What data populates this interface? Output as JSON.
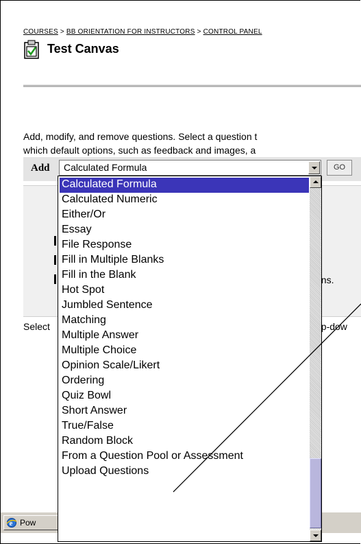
{
  "breadcrumb": {
    "items": [
      "Courses",
      "BB Orientation for Instructors",
      "Control Panel"
    ],
    "separator": ">"
  },
  "page": {
    "title": "Test Canvas",
    "title_icon": "checkbox-clipboard-icon"
  },
  "instructions": {
    "line1": "Add, modify, and remove questions. Select a question t",
    "line2": "which default options, such as feedback and images, a"
  },
  "add_bar": {
    "label": "Add",
    "selected_value": "Calculated Formula",
    "go_label": "GO"
  },
  "dropdown": {
    "options": [
      "Calculated Formula",
      "Calculated Numeric",
      "Either/Or",
      "Essay",
      "File Response",
      "Fill in Multiple Blanks",
      "Fill in the Blank",
      "Hot Spot",
      "Jumbled Sentence",
      "Matching",
      "Multiple Answer",
      "Multiple Choice",
      "Opinion Scale/Likert",
      "Ordering",
      "Quiz Bowl",
      "Short Answer",
      "True/False",
      "Random Block",
      "From a Question Pool or Assessment",
      "Upload Questions"
    ],
    "highlighted_index": 0,
    "highlight_color": "#3b35b8"
  },
  "fragments": {
    "panel_right": "ons.",
    "lower_left": "Select",
    "lower_right": "op-dow"
  },
  "taskbar": {
    "button_label": "Pow",
    "icon": "internet-explorer-icon"
  },
  "callout_target": "Random Block"
}
